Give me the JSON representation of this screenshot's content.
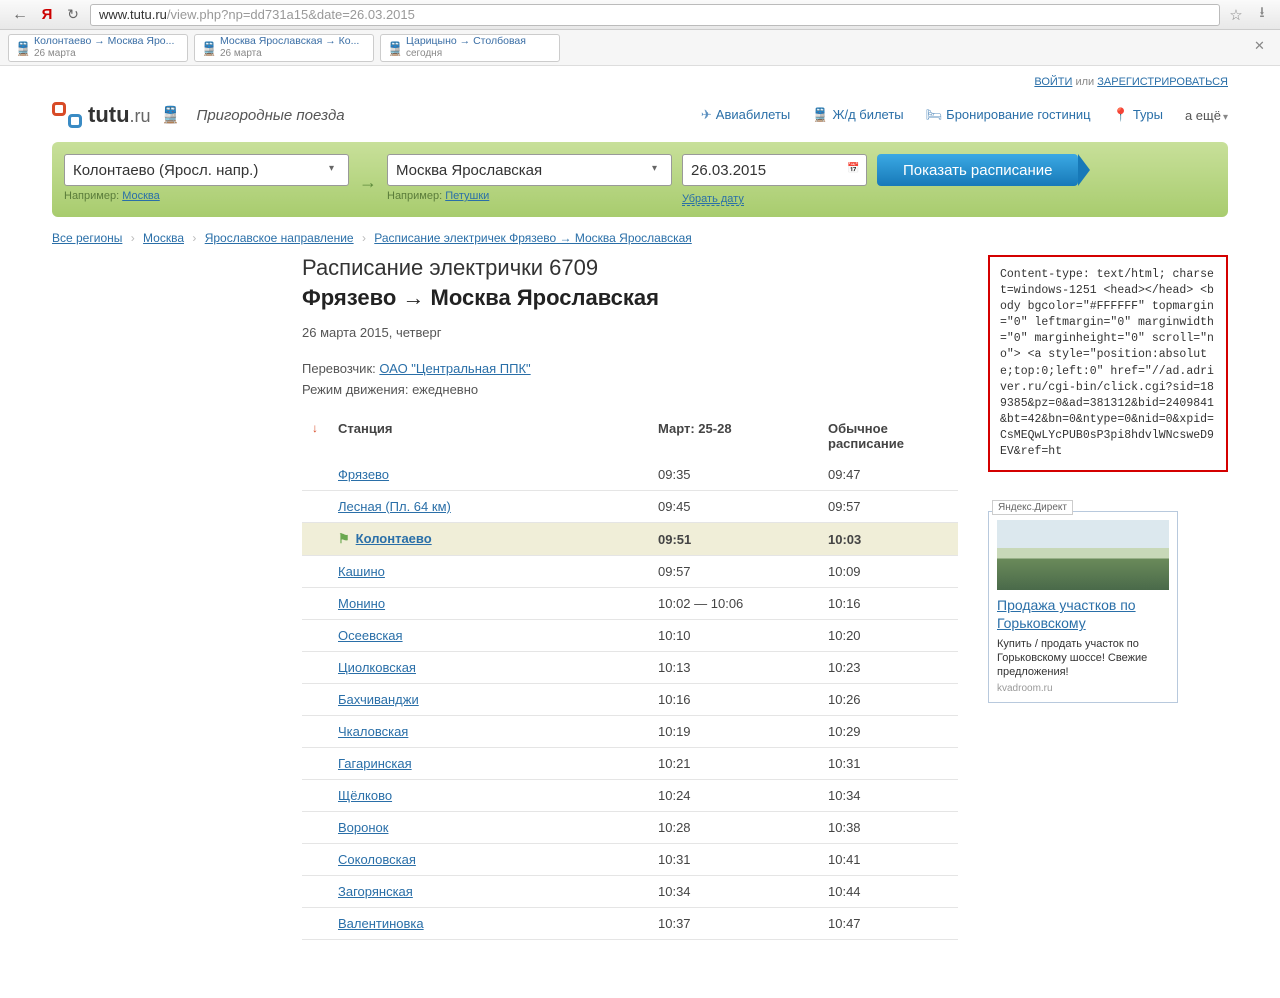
{
  "browser": {
    "url_host": "www.tutu.ru",
    "url_path": "/view.php?np=dd731a15&date=26.03.2015"
  },
  "tabs": [
    {
      "route": "Колонтаево → Москва Яро...",
      "date": "26 марта"
    },
    {
      "route": "Москва Ярославская → Ко...",
      "date": "26 марта"
    },
    {
      "route": "Царицыно → Столбовая",
      "date": "сегодня"
    }
  ],
  "auth": {
    "login": "ВОЙТИ",
    "or": " или ",
    "register": "ЗАРЕГИСТРИРОВАТЬСЯ"
  },
  "logo": {
    "name": "tutu",
    "suffix": ".ru",
    "subtitle": "Пригородные поезда"
  },
  "nav": {
    "avia": "Авиабилеты",
    "train": "Ж/д билеты",
    "hotel": "Бронирование гостиниц",
    "tours": "Туры",
    "more": "а ещё"
  },
  "search": {
    "from": "Колонтаево (Яросл. напр.)",
    "to": "Москва Ярославская",
    "date": "26.03.2015",
    "button": "Показать расписание",
    "hint_label": "Например: ",
    "hint_from": "Москва",
    "hint_to": "Петушки",
    "erase_date": "Убрать дату"
  },
  "breadcrumb": [
    "Все регионы",
    "Москва",
    "Ярославское направление",
    "Расписание электричек Фрязево → Москва Ярославская"
  ],
  "page": {
    "title1": "Расписание электрички 6709",
    "title2": "Фрязево → Москва Ярославская",
    "date_line": "26 марта 2015, четверг",
    "carrier_label": "Перевозчик: ",
    "carrier": "ОАО \"Центральная ППК\"",
    "mode_label": "Режим движения: ",
    "mode": "ежедневно"
  },
  "table_headers": {
    "station": "Станция",
    "period": "Март: 25-28",
    "usual": "Обычное расписание"
  },
  "rows": [
    {
      "station": "Фрязево",
      "t1": "09:35",
      "t2": "09:47"
    },
    {
      "station": "Лесная (Пл. 64 км)",
      "t1": "09:45",
      "t2": "09:57"
    },
    {
      "station": "Колонтаево",
      "t1": "09:51",
      "t2": "10:03",
      "highlight": true
    },
    {
      "station": "Кашино",
      "t1": "09:57",
      "t2": "10:09"
    },
    {
      "station": "Монино",
      "t1": "10:02 — 10:06",
      "t2": "10:16"
    },
    {
      "station": "Осеевская",
      "t1": "10:10",
      "t2": "10:20"
    },
    {
      "station": "Циолковская",
      "t1": "10:13",
      "t2": "10:23"
    },
    {
      "station": "Бахчиванджи",
      "t1": "10:16",
      "t2": "10:26"
    },
    {
      "station": "Чкаловская",
      "t1": "10:19",
      "t2": "10:29"
    },
    {
      "station": "Гагаринская",
      "t1": "10:21",
      "t2": "10:31"
    },
    {
      "station": "Щёлково",
      "t1": "10:24",
      "t2": "10:34"
    },
    {
      "station": "Воронок",
      "t1": "10:28",
      "t2": "10:38"
    },
    {
      "station": "Соколовская",
      "t1": "10:31",
      "t2": "10:41"
    },
    {
      "station": "Загорянская",
      "t1": "10:34",
      "t2": "10:44"
    },
    {
      "station": "Валентиновка",
      "t1": "10:37",
      "t2": "10:47"
    }
  ],
  "debug_text": "Content-type: text/html; charset=windows-1251\n\n\n<head></head>\n<body bgcolor=\"#FFFFFF\" topmargin=\"0\" leftmargin=\"0\" marginwidth=\"0\" marginheight=\"0\" scroll=\"no\">\n<a style=\"position:absolute;top:0;left:0\" href=\"//ad.adriver.ru/cgi-bin/click.cgi?sid=189385&pz=0&ad=381312&bid=2409841&bt=42&bn=0&ntype=0&nid=0&xpid=CsMEQwLYcPUB0sP3pi8hdvlWNcsweD9EV&ref=ht",
  "yandex_label": "Яндекс.Директ",
  "ad": {
    "title": "Продажа участков по Горьковскому",
    "text": "Купить / продать участок по Горьковскому шоссе! Свежие предложения!",
    "url": "kvadroom.ru"
  }
}
